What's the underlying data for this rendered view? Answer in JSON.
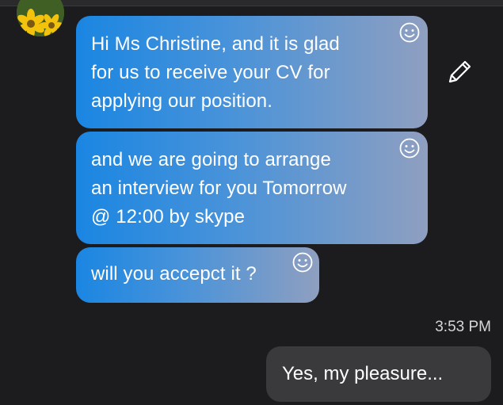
{
  "conversation": {
    "incoming_messages": [
      {
        "text": "Hi Ms Christine, and it is glad\nfor us to receive your CV for\napplying our position."
      },
      {
        "text": "and we are going to arrange\nan interview for you Tomorrow\n@ 12:00 by skype"
      },
      {
        "text": "will you accepct it ?"
      }
    ],
    "timestamp": "3:53 PM",
    "outgoing_message": {
      "text": "Yes, my pleasure..."
    }
  },
  "colors": {
    "background": "#1c1c1e",
    "incoming_gradient_start": "#1a86e2",
    "incoming_gradient_end": "#8f9fc0",
    "outgoing_bubble": "#3a3a3c"
  },
  "icons": {
    "reaction": "smiley-face-icon",
    "edit": "pencil-icon",
    "avatar": "sunflower-avatar"
  }
}
